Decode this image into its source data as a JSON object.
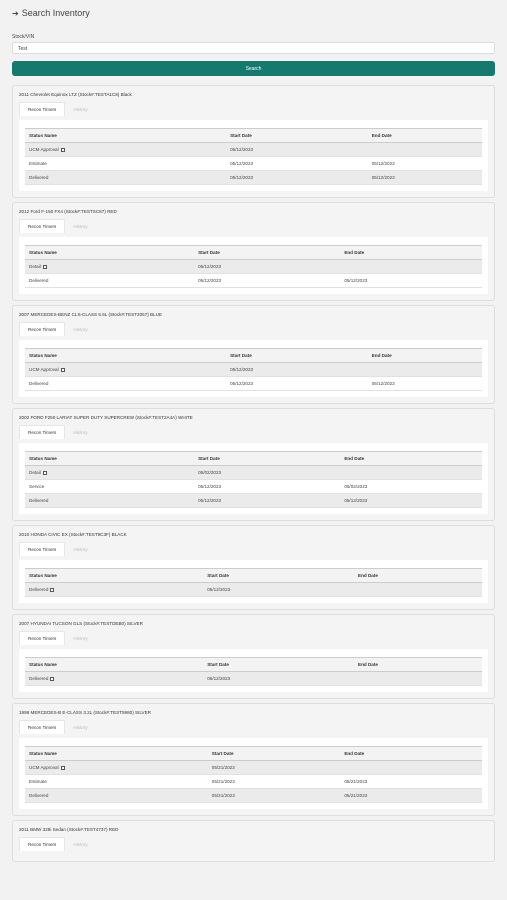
{
  "header": {
    "arrow_icon": "arrow-right-icon",
    "title": "Search Inventory"
  },
  "search": {
    "label": "Stock/VIN",
    "value": "Test",
    "button": "Search"
  },
  "tabs": {
    "active": "Recon Timers",
    "inactive": "History"
  },
  "columns": [
    "Status Name",
    "Start Date",
    "End Date"
  ],
  "vehicles": [
    {
      "title": "2011 Chevrolet Equinox LTZ (Stock#:TESTA1C8) Black",
      "col_widths": [
        "44%",
        "31%",
        "25%"
      ],
      "rows": [
        {
          "status": "UCM Approval",
          "link": true,
          "start": "05/12/2023",
          "end": ""
        },
        {
          "status": "Estimate",
          "link": false,
          "start": "05/12/2023",
          "end": "05/12/2023"
        },
        {
          "status": "Delivered",
          "link": false,
          "start": "05/12/2023",
          "end": "05/12/2023"
        }
      ]
    },
    {
      "title": "2012 Ford F-150 FX4 (Stock#:TESTSC87) RED",
      "col_widths": [
        "37%",
        "32%",
        "31%"
      ],
      "rows": [
        {
          "status": "Detail",
          "link": true,
          "start": "05/12/2023",
          "end": ""
        },
        {
          "status": "Delivered",
          "link": false,
          "start": "05/12/2023",
          "end": "05/12/2023"
        }
      ]
    },
    {
      "title": "2007 MERCEDES-BENZ CLS-CLASS 5.5L (Stock#:TEST2057) BLUE",
      "col_widths": [
        "44%",
        "31%",
        "25%"
      ],
      "rows": [
        {
          "status": "UCM Approval",
          "link": true,
          "start": "05/12/2023",
          "end": ""
        },
        {
          "status": "Delivered",
          "link": false,
          "start": "05/12/2023",
          "end": "05/12/2023"
        }
      ]
    },
    {
      "title": "2002 FORD F250 LARIAT SUPER DUTY SUPERCREW (Stock#:TEST2A4A) WHITE",
      "col_widths": [
        "37%",
        "32%",
        "31%"
      ],
      "rows": [
        {
          "status": "Detail",
          "link": true,
          "start": "05/02/2023",
          "end": ""
        },
        {
          "status": "Service",
          "link": false,
          "start": "05/12/2023",
          "end": "05/02/2023"
        },
        {
          "status": "Delivered",
          "link": false,
          "start": "05/12/2023",
          "end": "05/12/2023"
        }
      ]
    },
    {
      "title": "2010 HONDA CIVIC EX (Stock#:TEST9C3F) BLACK",
      "col_widths": [
        "39%",
        "33%",
        "28%"
      ],
      "rows": [
        {
          "status": "Delivered",
          "link": true,
          "start": "05/12/2023",
          "end": ""
        }
      ]
    },
    {
      "title": "2007 HYUNDAI TUCSON GLS (Stock#:TESTDEB0) SILVER",
      "col_widths": [
        "39%",
        "33%",
        "28%"
      ],
      "rows": [
        {
          "status": "Delivered",
          "link": true,
          "start": "05/12/2023",
          "end": ""
        }
      ]
    },
    {
      "title": "1998 MERCEDES-B E-CLASS 3.2L (Stock#:TEST5980) SILVER",
      "col_widths": [
        "40%",
        "29%",
        "31%"
      ],
      "rows": [
        {
          "status": "UCM Approval",
          "link": true,
          "start": "05/21/2023",
          "end": ""
        },
        {
          "status": "Estimate",
          "link": false,
          "start": "05/21/2023",
          "end": "05/21/2023"
        },
        {
          "status": "Delivered",
          "link": false,
          "start": "05/21/2023",
          "end": "05/21/2023"
        }
      ]
    },
    {
      "title": "2011 BMW 328i Sedan (Stock#:TEST4737) RED",
      "col_widths": [
        "40%",
        "29%",
        "31%"
      ],
      "rows": []
    }
  ]
}
